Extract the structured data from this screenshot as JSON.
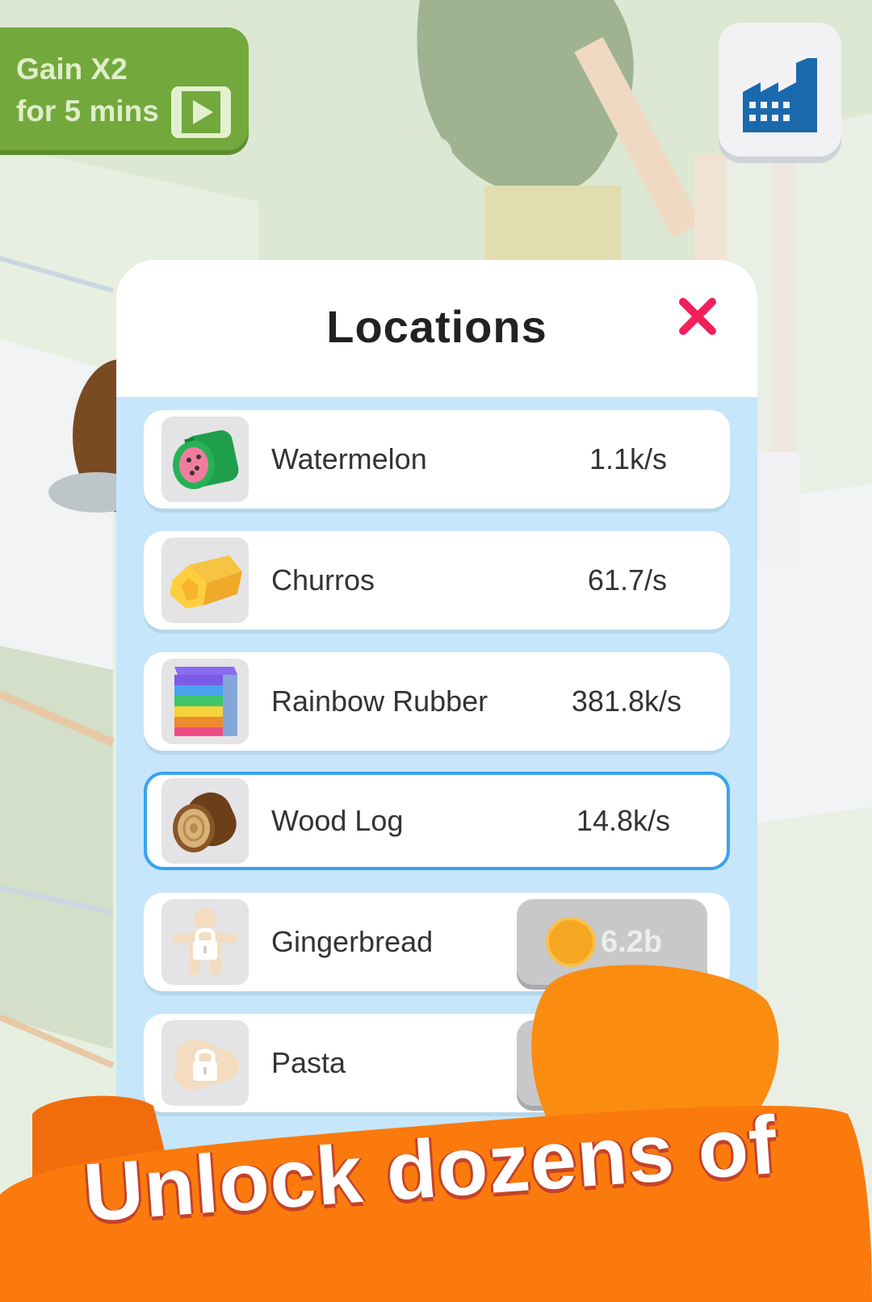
{
  "boost": {
    "line1": "Gain X2",
    "line2": "for 5 mins",
    "icon": "video-play-icon",
    "color": "#72a83c"
  },
  "factory": {
    "icon": "factory-icon",
    "color": "#1a69ad"
  },
  "locations": {
    "title": "Locations",
    "close_icon": "close-icon",
    "items": [
      {
        "name": "Watermelon",
        "rate": "1.1k/s",
        "icon": "watermelon-icon",
        "locked": false,
        "selected": false
      },
      {
        "name": "Churros",
        "rate": "61.7/s",
        "icon": "churros-icon",
        "locked": false,
        "selected": false
      },
      {
        "name": "Rainbow Rubber",
        "rate": "381.8k/s",
        "icon": "rainbow-rubber-icon",
        "locked": false,
        "selected": false
      },
      {
        "name": "Wood Log",
        "rate": "14.8k/s",
        "icon": "wood-log-icon",
        "locked": false,
        "selected": true
      },
      {
        "name": "Gingerbread",
        "price": "6.2b",
        "icon": "gingerbread-locked-icon",
        "locked": true,
        "selected": false
      },
      {
        "name": "Pasta",
        "icon": "pasta-locked-icon",
        "locked": true,
        "selected": false
      }
    ]
  },
  "promo": {
    "text": "Unlock dozens of",
    "color": "#f98d0e"
  }
}
